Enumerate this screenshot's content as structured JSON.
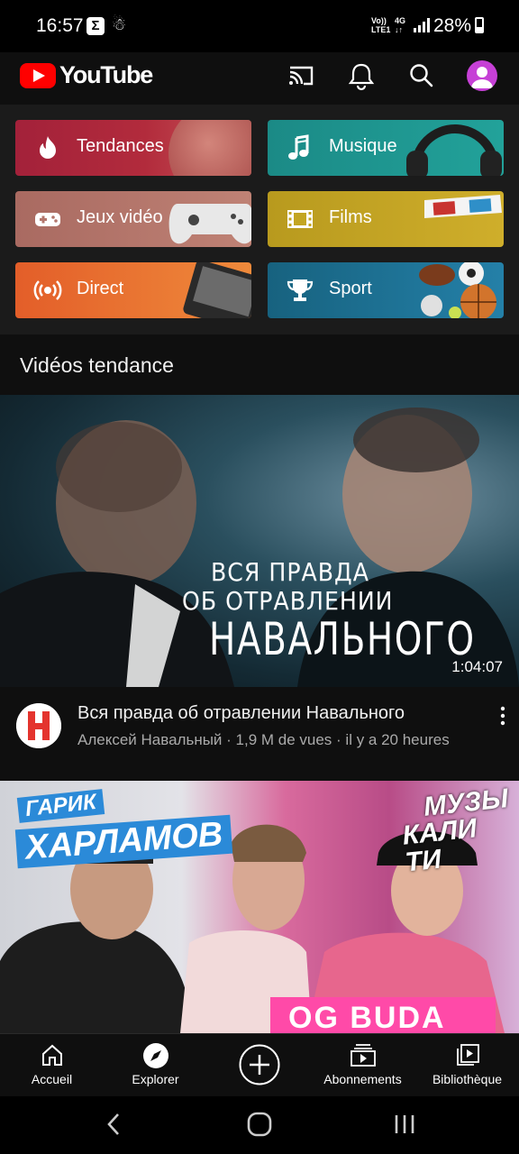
{
  "status_bar": {
    "time": "16:57",
    "sigma_badge": "Σ",
    "network_volte": "Vo))",
    "network_lte": "LTE1",
    "network_4g": "4G",
    "battery": "28%"
  },
  "header": {
    "logo_text": "YouTube"
  },
  "categories": [
    {
      "label": "Tendances",
      "icon": "flame-icon",
      "color": "#b3283b"
    },
    {
      "label": "Musique",
      "icon": "music-note-icon",
      "color": "#1f8f8a"
    },
    {
      "label": "Jeux vidéo",
      "icon": "gamepad-icon",
      "color": "#b3766c"
    },
    {
      "label": "Films",
      "icon": "film-strip-icon",
      "color": "#c3a521"
    },
    {
      "label": "Direct",
      "icon": "live-broadcast-icon",
      "color": "#e4692a"
    },
    {
      "label": "Sport",
      "icon": "trophy-icon",
      "color": "#1d6f93"
    }
  ],
  "section_title": "Vidéos tendance",
  "videos": [
    {
      "thumbnail_text_line1": "ВСЯ ПРАВДА",
      "thumbnail_text_line2": "ОБ ОТРАВЛЕНИИ",
      "thumbnail_text_line3": "НАВАЛЬНОГО",
      "duration": "1:04:07",
      "title": "Вся правда об отравлении Навального",
      "subtitle": "Алексей Навальный · 1,9 M de vues · il y a 20 heures"
    },
    {
      "thumbnail_text_top": "ГАРИК",
      "thumbnail_text_name": "ХАРЛАМОВ",
      "thumbnail_text_right1": "МУЗЫ",
      "thumbnail_text_right2": "КАЛИ ТИ",
      "thumbnail_text_bottom": "OG BUDA"
    }
  ],
  "bottom_nav": [
    {
      "label": "Accueil",
      "icon": "home-icon"
    },
    {
      "label": "Explorer",
      "icon": "compass-icon"
    },
    {
      "label": "",
      "icon": "add-circle-icon"
    },
    {
      "label": "Abonnements",
      "icon": "subscriptions-icon"
    },
    {
      "label": "Bibliothèque",
      "icon": "library-icon"
    }
  ]
}
